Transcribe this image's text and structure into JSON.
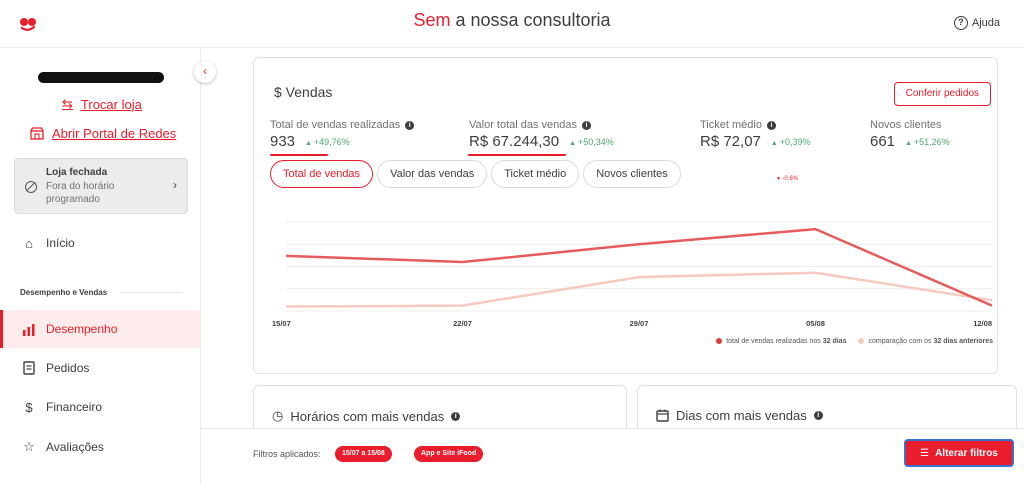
{
  "header": {
    "title_accent": "Sem",
    "title_rest": " a nossa consultoria",
    "help_label": "Ajuda",
    "brand_color": "#ea1d2c"
  },
  "sidebar": {
    "change_store_label": "Trocar loja",
    "open_portal_label": "Abrir Portal de Redes",
    "store_status": {
      "title": "Loja fechada",
      "subtitle": "Fora do horário programado"
    },
    "items": [
      {
        "label": "Início",
        "icon": "home-icon"
      },
      {
        "label": "Desempenho",
        "icon": "chart-icon",
        "active": true
      },
      {
        "label": "Pedidos",
        "icon": "receipt-icon"
      },
      {
        "label": "Financeiro",
        "icon": "dollar-icon"
      },
      {
        "label": "Avaliações",
        "icon": "star-icon"
      }
    ],
    "section_label": "Desempenho e Vendas"
  },
  "sales": {
    "title": "$ Vendas",
    "orders_button": "Conferir pedidos",
    "kpis": [
      {
        "label": "Total de vendas realizadas",
        "value": "933",
        "delta": "+49,76%"
      },
      {
        "label": "Valor total das vendas",
        "value": "R$ 67.244,30",
        "delta": "+50,34%"
      },
      {
        "label": "Ticket médio",
        "value": "R$ 72,07",
        "delta": "+0,39%"
      },
      {
        "label": "Novos clientes",
        "value": "661",
        "delta": "+51,26%"
      }
    ],
    "tabs": [
      "Total de vendas",
      "Valor das vendas",
      "Ticket médio",
      "Novos clientes"
    ],
    "stray_delta": "-0,6%"
  },
  "chart_data": {
    "type": "line",
    "x": [
      "15/07",
      "22/07",
      "29/07",
      "05/08",
      "12/08"
    ],
    "series": [
      {
        "name": "total de vendas realizadas nos 32 dias",
        "color": "#e65b5b",
        "values": [
          0.62,
          0.55,
          0.75,
          0.92,
          0.06
        ]
      },
      {
        "name": "comparação com os 32 dias anteriores",
        "color": "#f7c9c0",
        "values": [
          0.05,
          0.06,
          0.38,
          0.43,
          0.12
        ]
      }
    ],
    "ylim": [
      0,
      1
    ],
    "grid": true,
    "legend": [
      {
        "prefix": "total de vendas realizadas nos ",
        "bold": "32 dias"
      },
      {
        "prefix": "comparação com os ",
        "bold": "32 dias anteriores"
      }
    ]
  },
  "hours_card": {
    "title": "Horários com mais vendas"
  },
  "days_card": {
    "title": "Dias com mais vendas"
  },
  "filters": {
    "label": "Filtros aplicados:",
    "chips": [
      "15/07 a 15/08",
      "App e Site iFood"
    ],
    "button": "Alterar filtros"
  }
}
